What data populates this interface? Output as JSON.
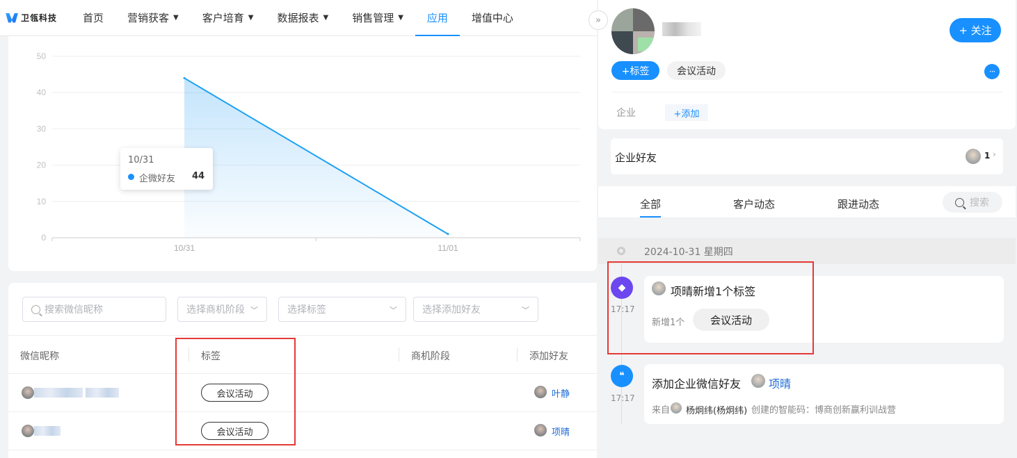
{
  "brand": {
    "name": "卫瓴科技"
  },
  "nav": {
    "items": [
      {
        "label": "首页",
        "caret": false,
        "active": false
      },
      {
        "label": "营销获客",
        "caret": true,
        "active": false
      },
      {
        "label": "客户培育",
        "caret": true,
        "active": false
      },
      {
        "label": "数据报表",
        "caret": true,
        "active": false
      },
      {
        "label": "销售管理",
        "caret": true,
        "active": false
      },
      {
        "label": "应用",
        "caret": false,
        "active": true
      },
      {
        "label": "增值中心",
        "caret": false,
        "active": false
      }
    ]
  },
  "chart_data": {
    "type": "area",
    "categories": [
      "10/31",
      "11/01"
    ],
    "series": [
      {
        "name": "企微好友",
        "values": [
          44,
          1
        ]
      }
    ],
    "ylim": [
      0,
      50
    ],
    "yticks": [
      0,
      10,
      20,
      30,
      40,
      50
    ],
    "grid": true,
    "color": "#1da1f2",
    "tooltip": {
      "date": "10/31",
      "name": "企微好友",
      "value": "44"
    }
  },
  "filters": {
    "search_placeholder": "搜索微信昵称",
    "stage_placeholder": "选择商机阶段",
    "tag_placeholder": "选择标签",
    "friend_placeholder": "选择添加好友"
  },
  "table": {
    "headers": {
      "nickname": "微信昵称",
      "tag": "标签",
      "stage": "商机阶段",
      "friend": "添加好友"
    },
    "rows": [
      {
        "tag": "会议活动",
        "friend": "叶静"
      },
      {
        "tag": "会议活动",
        "friend": "项晴"
      }
    ]
  },
  "profile": {
    "follow_label": "+ 关注",
    "add_tag_label": "+标签",
    "tag": "会议活动",
    "more_label": "···",
    "company_label": "企业",
    "company_add_label": "+添加",
    "friends_label": "企业好友",
    "friends_count": "1"
  },
  "tabs": {
    "all": "全部",
    "customer": "客户动态",
    "followup": "跟进动态",
    "search_placeholder": "搜索"
  },
  "timeline": {
    "date": "2024-10-31 星期四",
    "events": [
      {
        "time": "17:17",
        "title": "项晴新增1个标签",
        "sub_label": "新增1个",
        "tag": "会议活动"
      },
      {
        "time": "17:17",
        "title": "添加企业微信好友",
        "person": "项晴",
        "from_label": "来自",
        "from_person": "杨炯纬(杨炯纬)",
        "detail": "创建的智能码：博商创新赢利训战营"
      }
    ]
  },
  "colors": {
    "accent": "#1890ff",
    "highlight": "#e53935",
    "tag_event": "#6c47f0"
  }
}
